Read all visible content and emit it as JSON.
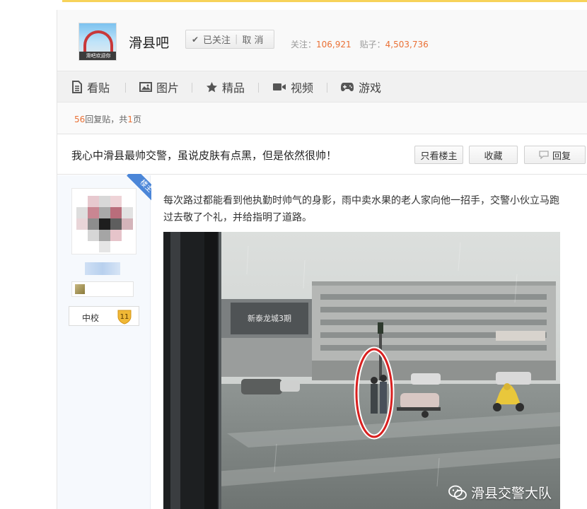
{
  "forum": {
    "name": "滑县吧",
    "logo_text": "滑吧欢迎你",
    "follow_label": "已关注",
    "cancel_label": "取 消",
    "followers_label": "关注：",
    "followers": "106,921",
    "posts_label": "贴子：",
    "posts": "4,503,736"
  },
  "nav": {
    "items": [
      {
        "label": "看贴",
        "icon": "document-icon"
      },
      {
        "label": "图片",
        "icon": "image-icon"
      },
      {
        "label": "精品",
        "icon": "star-icon"
      },
      {
        "label": "视频",
        "icon": "video-camera-icon"
      },
      {
        "label": "游戏",
        "icon": "gamepad-icon"
      }
    ]
  },
  "reply_bar": {
    "count": "56",
    "count_suffix": "回复贴，共",
    "pages": "1",
    "pages_suffix": "页"
  },
  "thread": {
    "title": "我心中滑县最帅交警，虽说皮肤有点黑，但是依然很帅！",
    "buttons": {
      "only_op": "只看楼主",
      "favorite": "收藏",
      "reply": "回复"
    }
  },
  "author": {
    "badge": "楼主",
    "level_name": "中校",
    "level": "11"
  },
  "post": {
    "text": "每次路过都能看到他执勤时帅气的身影，雨中卖水果的老人家向他一招手，交警小伙立马跑过去敬了个礼，并给指明了道路。",
    "image": {
      "sign_text": "新泰龙城3期",
      "watermark": "滑县交警大队"
    }
  },
  "colors": {
    "accent": "#ea7035",
    "badge_blue": "#4b86d8",
    "top_strip": "#f7d35a"
  }
}
